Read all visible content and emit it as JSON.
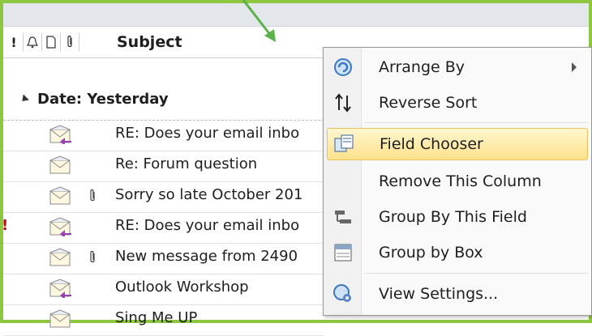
{
  "header": {
    "icons": [
      "importance-icon",
      "reminder-bell-icon",
      "document-icon",
      "attachment-icon"
    ],
    "importance_glyph": "!",
    "subject_label": "Subject"
  },
  "group": {
    "label": "Date: Yesterday"
  },
  "messages": [
    {
      "subject": "RE: Does your email inbo",
      "icon": "replied-envelope-icon",
      "attachment": false,
      "flag": ""
    },
    {
      "subject": "Re: Forum question",
      "icon": "envelope-icon",
      "attachment": false,
      "flag": ""
    },
    {
      "subject": "Sorry so late October 201",
      "icon": "envelope-icon",
      "attachment": true,
      "flag": ""
    },
    {
      "subject": "RE: Does your email inbo",
      "icon": "replied-envelope-icon",
      "attachment": false,
      "flag": "!"
    },
    {
      "subject": "New message from 2490",
      "icon": "envelope-icon",
      "attachment": true,
      "flag": ""
    },
    {
      "subject": "Outlook Workshop",
      "icon": "replied-envelope-icon",
      "attachment": false,
      "flag": ""
    },
    {
      "subject": "Sing Me UP",
      "icon": "envelope-icon",
      "attachment": false,
      "flag": ""
    }
  ],
  "context_menu": {
    "items": [
      {
        "label": "Arrange By",
        "icon": "arrange-by-icon",
        "submenu": true
      },
      {
        "label": "Reverse Sort",
        "icon": "reverse-sort-icon",
        "submenu": false
      },
      {
        "label": "Field Chooser",
        "icon": "field-chooser-icon",
        "submenu": false,
        "highlighted": true
      },
      {
        "label": "Remove This Column",
        "icon": "",
        "submenu": false
      },
      {
        "label": "Group By This Field",
        "icon": "group-by-field-icon",
        "submenu": false
      },
      {
        "label": "Group by Box",
        "icon": "group-by-box-icon",
        "submenu": false
      },
      {
        "label": "View Settings...",
        "icon": "view-settings-icon",
        "submenu": false
      }
    ]
  },
  "colors": {
    "frame": "#8dc63f",
    "highlight": "#fde28a",
    "flag": "#d40000"
  }
}
